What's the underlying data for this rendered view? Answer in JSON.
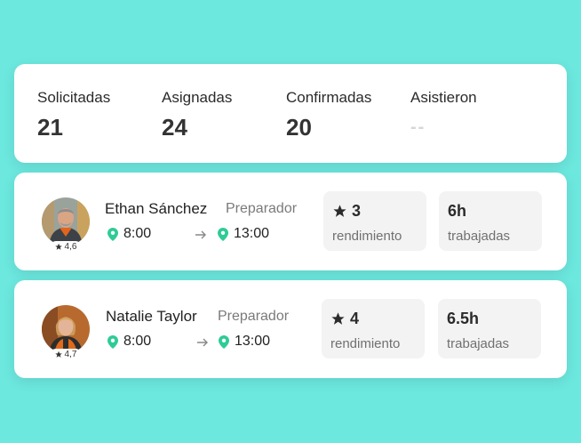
{
  "stats": [
    {
      "label": "Solicitadas",
      "value": "21"
    },
    {
      "label": "Asignadas",
      "value": "24"
    },
    {
      "label": "Confirmadas",
      "value": "20"
    },
    {
      "label": "Asistieron",
      "value": "--"
    }
  ],
  "workers": [
    {
      "name": "Ethan Sánchez",
      "role": "Preparador",
      "rating": "4,6",
      "start": "8:00",
      "end": "13:00",
      "performance": "3",
      "performance_label": "rendimiento",
      "hours": "6h",
      "hours_label": "trabajadas"
    },
    {
      "name": "Natalie Taylor",
      "role": "Preparador",
      "rating": "4,7",
      "start": "8:00",
      "end": "13:00",
      "performance": "4",
      "performance_label": "rendimiento",
      "hours": "6.5h",
      "hours_label": "trabajadas"
    }
  ],
  "colors": {
    "background": "#6ce8df",
    "pin": "#2fcb97",
    "metric_bg": "#f3f3f3"
  },
  "icons": [
    "star-icon",
    "location-pin-icon",
    "arrow-right-icon"
  ]
}
